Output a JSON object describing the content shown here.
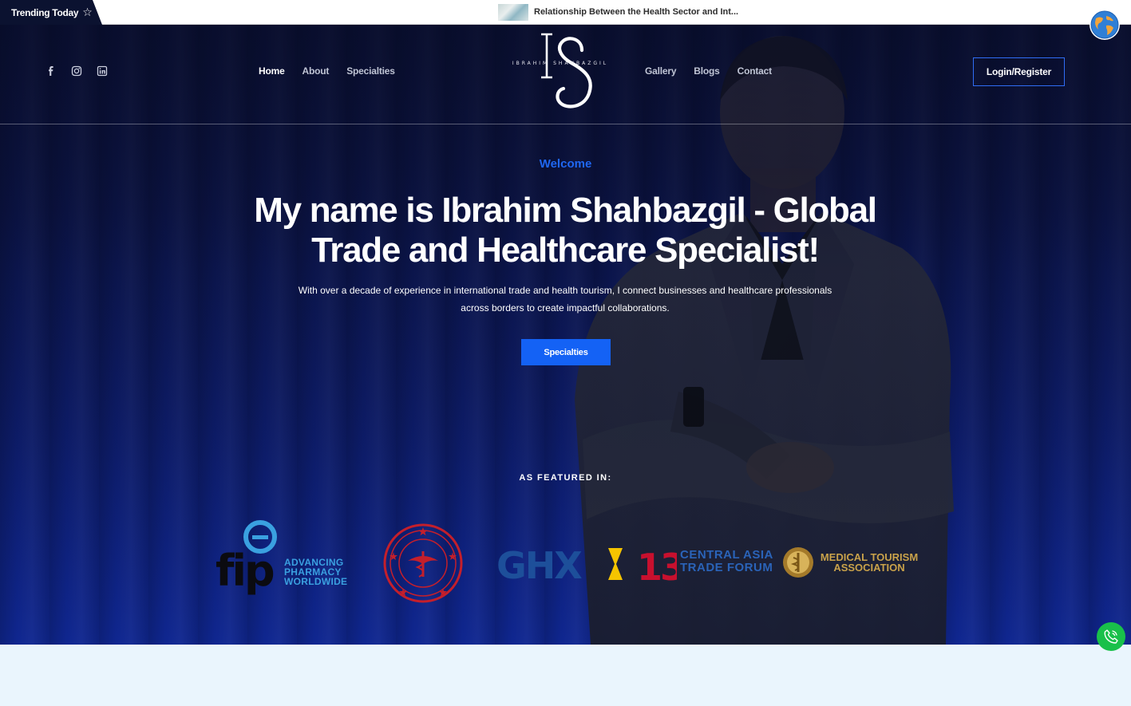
{
  "topbar": {
    "trending_label": "Trending Today",
    "trending_icon": "star-outline-icon",
    "trending_item_title": "Relationship Between the Health Sector and Int..."
  },
  "header": {
    "social_icons": [
      "facebook-icon",
      "instagram-icon",
      "linkedin-icon"
    ],
    "nav_left": [
      "Home",
      "About",
      "Specialties"
    ],
    "nav_right": [
      "Gallery",
      "Blogs",
      "Contact"
    ],
    "active_nav": "Home",
    "logo_monogram": "IS",
    "logo_name": "IBRAHIM SHAHBAZGIL",
    "login_label": "Login/Register"
  },
  "hero": {
    "eyebrow": "Welcome",
    "headline": "My name is Ibrahim Shahbazgil - Global Trade and Healthcare Specialist!",
    "subtext": "With over a decade of experience in international trade and health tourism, I connect businesses and healthcare professionals across borders to create impactful collaborations.",
    "cta_label": "Specialties",
    "featured_label": "AS FEATURED IN:"
  },
  "featured_logos": {
    "fip": {
      "wordmark": "fip",
      "tagline_1": "ADVANCING",
      "tagline_2": "PHARMACY",
      "tagline_3": "WORLDWIDE"
    },
    "ghx": {
      "wordmark": "GHX",
      "number": "13"
    },
    "catf": {
      "line_1": "CENTRAL ASIA",
      "line_2": "TRADE FORUM"
    },
    "mta": {
      "line_1": "MEDICAL TOURISM",
      "line_2": "ASSOCIATION"
    }
  },
  "colors": {
    "accent_blue": "#1462f5",
    "hero_dark": "#0a1034",
    "whatsapp_green": "#19c04a"
  },
  "floating": {
    "globe_icon": "globe-icon",
    "phone_icon": "phone-call-icon"
  }
}
